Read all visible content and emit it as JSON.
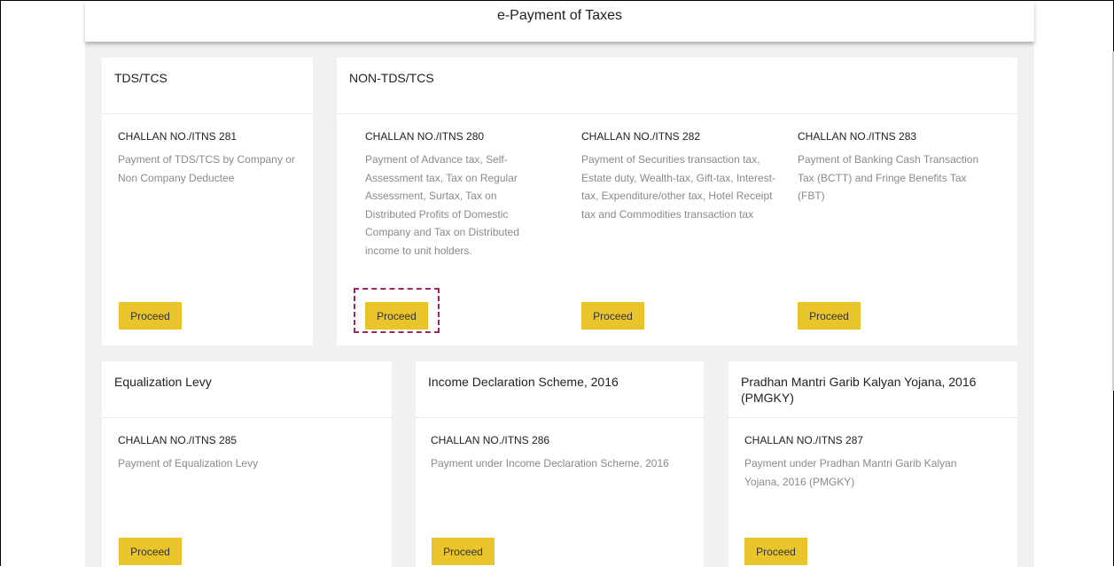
{
  "page": {
    "title": "e-Payment of Taxes"
  },
  "cards": {
    "tds": {
      "title": "TDS/TCS",
      "challan": "CHALLAN NO./ITNS 281",
      "desc": "Payment of TDS/TCS by Company or Non Company Deductee"
    },
    "non_tds": {
      "title": "NON-TDS/TCS",
      "items": [
        {
          "challan": "CHALLAN NO./ITNS 280",
          "desc": "Payment of Advance tax, Self-Assessment tax, Tax on Regular Assessment, Surtax, Tax on Distributed Profits of Domestic Company and Tax on Distributed income to unit holders."
        },
        {
          "challan": "CHALLAN NO./ITNS 282",
          "desc": "Payment of Securities transaction tax, Estate duty, Wealth-tax, Gift-tax, Interest-tax, Expenditure/other tax, Hotel Receipt tax and Commodities transaction tax"
        },
        {
          "challan": "CHALLAN NO./ITNS 283",
          "desc": "Payment of Banking Cash Transaction Tax (BCTT) and Fringe Benefits Tax (FBT)"
        }
      ]
    },
    "equalization": {
      "title": "Equalization Levy",
      "challan": "CHALLAN NO./ITNS 285",
      "desc": "Payment of Equalization Levy"
    },
    "ids": {
      "title": "Income Declaration Scheme, 2016",
      "challan": "CHALLAN NO./ITNS 286",
      "desc": "Payment under Income Declaration Scheme, 2016"
    },
    "pmgky": {
      "title": "Pradhan Mantri Garib Kalyan Yojana, 2016 (PMGKY)",
      "challan": "CHALLAN NO./ITNS 287",
      "desc": "Payment under Pradhan Mantri Garib Kalyan Yojana, 2016 (PMGKY)"
    }
  },
  "buttons": {
    "proceed_label": "Proceed"
  },
  "colors": {
    "button": "#e9c42a",
    "highlight": "#a0275e",
    "background": "#f1f1f1"
  }
}
